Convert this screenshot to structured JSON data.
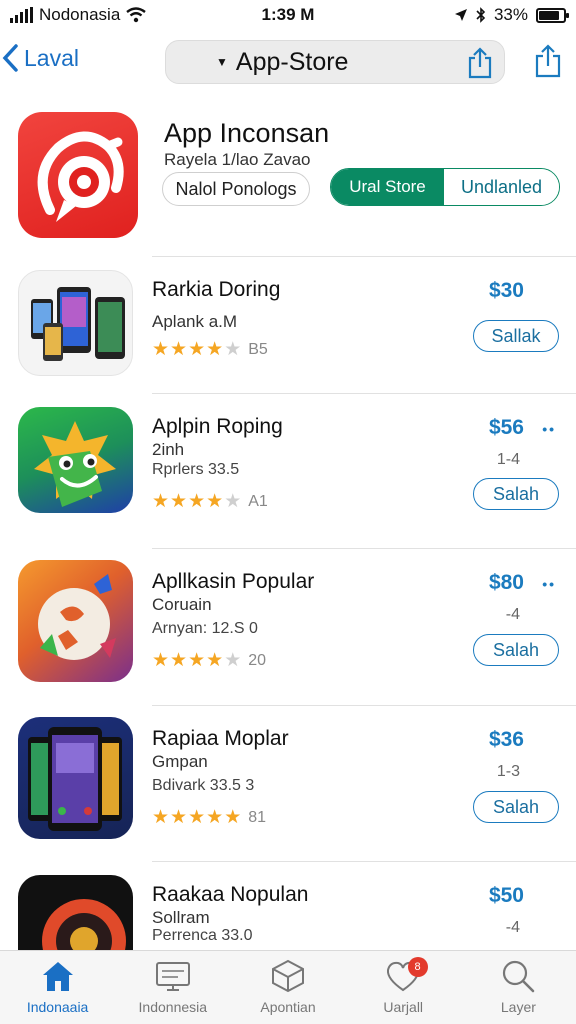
{
  "status_bar": {
    "carrier": "Nodonasia",
    "time": "1:39 M",
    "battery": "33%",
    "battery_level": 0.85,
    "icons": [
      "signal-icon",
      "wifi-icon",
      "location-icon",
      "bluetooth-icon",
      "battery-icon"
    ]
  },
  "nav": {
    "back_label": "Laval",
    "title": "App-Store",
    "icons": [
      "chevron-left-icon",
      "share-icon"
    ]
  },
  "featured": {
    "title": "App Inconsan",
    "subtitle": "Rayela 1/lao Zavao",
    "button_label": "Nalol Ponologs",
    "segment_active": "Ural Store",
    "segment_other": "Undlanled",
    "colors": {
      "accent": "#0a8a63",
      "icon": "#e0211f"
    }
  },
  "apps": [
    {
      "name": "Rarkia Doring",
      "line2": "Aplank a.M",
      "line3": "",
      "stars": 4,
      "rating_count": "B5",
      "price": "$30",
      "meta": "",
      "button": "Sallak",
      "has_dots": false
    },
    {
      "name": "Aplpin Roping",
      "line2": "2inh",
      "line3": "Rprlers 33.5",
      "stars": 4,
      "rating_count": "A1",
      "price": "$56",
      "meta": "1-4",
      "button": "Salah",
      "has_dots": true
    },
    {
      "name": "Apllkasin Popular",
      "line2": "Coruain",
      "line3": "Arnyan: 12.S     0",
      "stars": 4,
      "rating_count": "20",
      "price": "$80",
      "meta": "-4",
      "button": "Salah",
      "has_dots": true
    },
    {
      "name": "Rapiaa Moplar",
      "line2": "Gmpan",
      "line3": "Bdivark 33.5     3",
      "stars": 5,
      "rating_count": "81",
      "price": "$36",
      "meta": "1-3",
      "button": "Salah",
      "has_dots": false
    },
    {
      "name": "Raakaa Nopulan",
      "line2": "Sollram",
      "line3": "Perrenca 33.0",
      "stars": 0,
      "rating_count": "",
      "price": "$50",
      "meta": "-4",
      "button": "",
      "has_dots": false
    }
  ],
  "tabs": [
    {
      "label": "Indonaaia",
      "icon": "home-icon",
      "active": true
    },
    {
      "label": "Indonnesia",
      "icon": "monitor-icon",
      "active": false
    },
    {
      "label": "Apontian",
      "icon": "box-icon",
      "active": false
    },
    {
      "label": "Uarjall",
      "icon": "heart-icon",
      "active": false,
      "badge": "8"
    },
    {
      "label": "Layer",
      "icon": "search-icon",
      "active": false
    }
  ]
}
